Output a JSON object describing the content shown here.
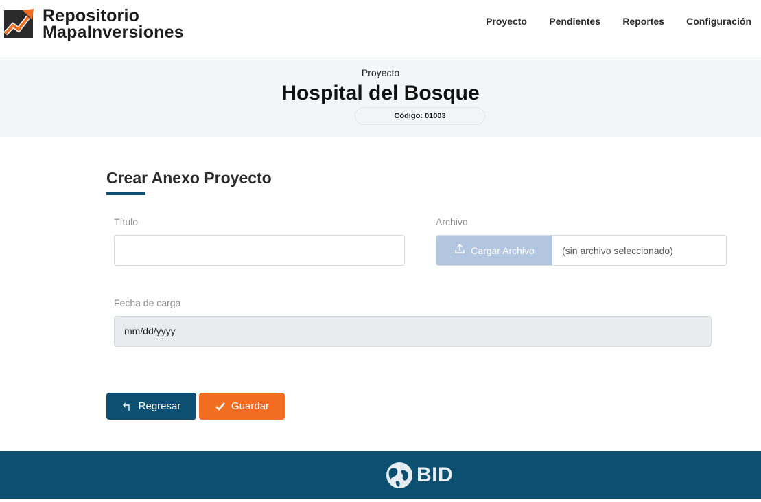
{
  "header": {
    "brand_line1": "Repositorio",
    "brand_line2": "MapaInversiones",
    "nav": {
      "proyecto": "Proyecto",
      "pendientes": "Pendientes",
      "reportes": "Reportes",
      "configuracion": "Configuración"
    }
  },
  "project": {
    "label": "Proyecto",
    "name": "Hospital del Bosque",
    "code": "Código: 01003"
  },
  "form": {
    "title": "Crear Anexo Proyecto",
    "titulo_label": "Título",
    "titulo_value": "",
    "archivo_label": "Archivo",
    "file_button": "Cargar Archivo",
    "file_status": "(sin archivo seleccionado)",
    "fecha_label": "Fecha de carga",
    "fecha_placeholder": "mm/dd/yyyy"
  },
  "actions": {
    "back": "Regresar",
    "save": "Guardar"
  },
  "footer": {
    "logo_text": "BID"
  },
  "colors": {
    "primary": "#0c4f70",
    "accent": "#f16d22",
    "file_button": "#b3c6e0"
  },
  "icons": {
    "brand": "trend-arrow-logo-icon",
    "upload": "upload-icon",
    "back": "return-arrow-icon",
    "save": "check-icon",
    "footer": "bid-globe-icon"
  }
}
